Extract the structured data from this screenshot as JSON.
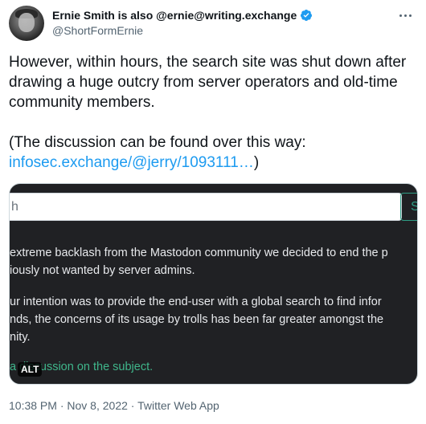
{
  "author": {
    "display_name": "Ernie Smith is also @ernie@writing.exchange",
    "handle": "@ShortFormErnie"
  },
  "tweet": {
    "text_main": "However, within hours, the search site was shut down after drawing a huge outcry from server operators and old-time community members.",
    "text_paren": "(The discussion can be found over this way:",
    "link": "infosec.exchange/@jerry/1093111…",
    "link_suffix": ")"
  },
  "media": {
    "search_value": "h",
    "search_button": "S",
    "para1": [
      "extreme backlash from the Mastodon community we decided to end the p",
      "iously not wanted by server admins."
    ],
    "para2": [
      "ur intention was to provide the end-user with a global search to find infor",
      "nds, the concerns of its usage by trolls has been far greater amongst the",
      "nity."
    ],
    "link_text": "a discussion on the subject.",
    "alt_badge": "ALT"
  },
  "meta": {
    "time": "10:38 PM",
    "date": "Nov 8, 2022",
    "source": "Twitter Web App",
    "separator": " · "
  },
  "colors": {
    "link": "#1d9bf0",
    "verified": "#1d9bf0",
    "media_bg": "#202124",
    "media_link": "#3fb68b"
  },
  "icons": [
    "verified-badge-icon",
    "more-options-icon"
  ]
}
